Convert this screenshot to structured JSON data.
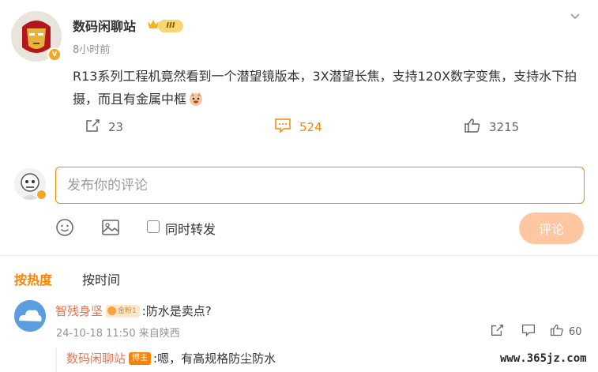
{
  "post": {
    "username": "数码闲聊站",
    "level_badge": "III",
    "verified_mark": "v",
    "time": "8小时前",
    "text": "R13系列工程机竟然看到一个潜望镜版本，3X潜望长焦，支持120X数字变焦，支持水下拍摄，而且有金属中框",
    "emoji_icon": "doge-emoji",
    "reposts": "23",
    "comments": "524",
    "likes": "3215",
    "accent_color": "#ff8200"
  },
  "compose": {
    "placeholder": "发布你的评论",
    "repost_label": "同时转发",
    "submit_label": "评论"
  },
  "sort": {
    "hot_label": "按热度",
    "time_label": "按时间"
  },
  "comments": [
    {
      "username": "智残身坚",
      "fan_badge": "金粉1",
      "text": ":防水是卖点?",
      "meta": "24-10-18 11:50 来自陕西",
      "likes": "60",
      "reply": {
        "username": "数码闲聊站",
        "owner_badge": "博主",
        "text": ":嗯，有高规格防尘防水"
      }
    }
  ],
  "watermark": "www.365jz.com"
}
